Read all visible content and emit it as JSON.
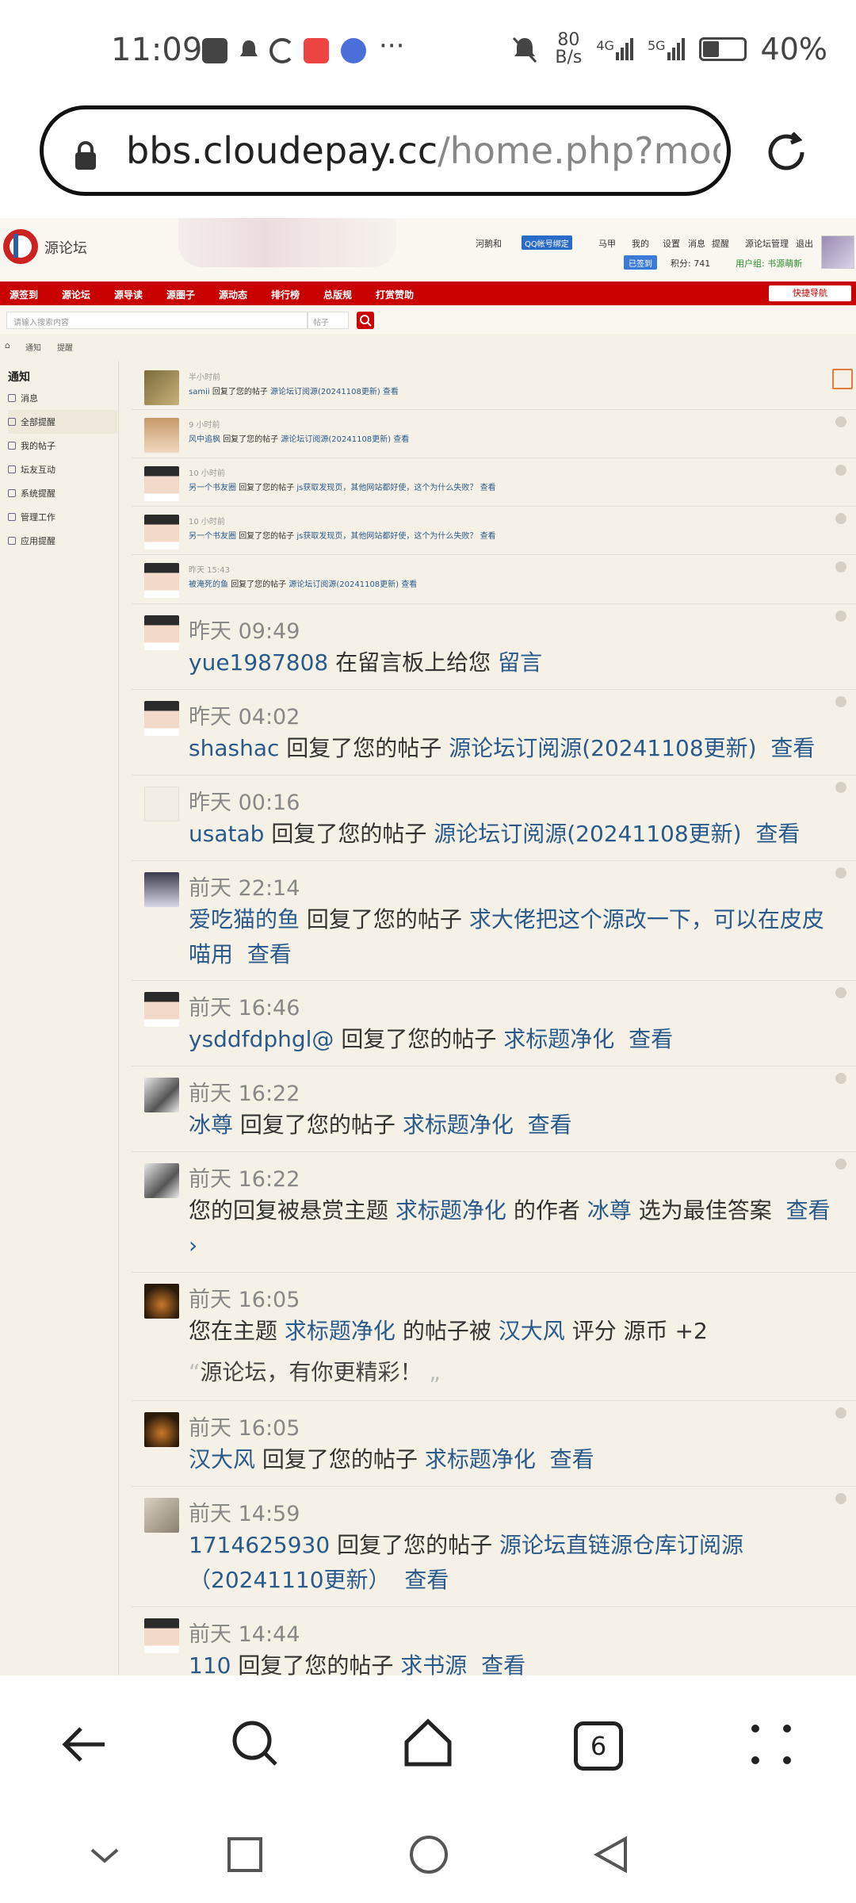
{
  "status_bar": {
    "time": "11:09",
    "net_speed_value": "80",
    "net_speed_unit": "B/s",
    "sig1": "4G",
    "sig2": "5G",
    "battery": "40%"
  },
  "browser": {
    "url_host": "bbs.cloudepay.cc",
    "url_path": "/home.php?mod=",
    "tab_count": "6"
  },
  "site": {
    "topnav": [
      "河鹅和",
      "QQ帐号绑定",
      "马甲",
      "我的",
      "设置",
      "消息",
      "提醒",
      "源论坛管理",
      "退出"
    ],
    "sign_label": "已签到",
    "points": "积分: 741",
    "group": "用户组: 书源萌新",
    "red_nav": [
      "源签到",
      "源论坛",
      "源导读",
      "源圈子",
      "源动态",
      "排行榜",
      "总版规",
      "打赏赞助"
    ],
    "quick_nav": "快捷导航",
    "search_placeholder": "请输入搜索内容",
    "search_select": "帖子",
    "breadcrumb": [
      "通知",
      "提醒"
    ]
  },
  "sidebar": {
    "title": "通知",
    "items": [
      {
        "label": "消息"
      },
      {
        "label": "全部提醒"
      },
      {
        "label": "我的帖子"
      },
      {
        "label": "坛友互动"
      },
      {
        "label": "系统提醒"
      },
      {
        "label": "管理工作"
      },
      {
        "label": "应用提醒"
      }
    ]
  },
  "notices_small": [
    {
      "time": "半小时前",
      "user": "samii",
      "action": "回复了您的帖子",
      "link": "源论坛订阅源(20241108更新)",
      "view": "查看"
    },
    {
      "time": "9 小时前",
      "user": "风中追枫",
      "action": "回复了您的帖子",
      "link": "源论坛订阅源(20241108更新)",
      "view": "查看"
    },
    {
      "time": "10 小时前",
      "user": "另一个书友圈",
      "action": "回复了您的帖子",
      "link": "js获取发现页，其他网站都好使，这个为什么失败？",
      "view": "查看"
    },
    {
      "time": "10 小时前",
      "user": "另一个书友圈",
      "action": "回复了您的帖子",
      "link": "js获取发现页，其他网站都好使，这个为什么失败？",
      "view": "查看"
    },
    {
      "time": "昨天 15:43",
      "user": "被淹死的鱼",
      "action": "回复了您的帖子",
      "link": "源论坛订阅源(20241108更新)",
      "view": "查看"
    }
  ],
  "notices_big": [
    {
      "time": "昨天 09:49",
      "user": "yue1987808",
      "action": "在留言板上给您",
      "link": "留言",
      "view": ""
    },
    {
      "time": "昨天 04:02",
      "user": "shashac",
      "action": "回复了您的帖子",
      "link": "源论坛订阅源(20241108更新)",
      "view": "查看"
    },
    {
      "time": "昨天 00:16",
      "user": "usatab",
      "action": "回复了您的帖子",
      "link": "源论坛订阅源(20241108更新)",
      "view": "查看"
    },
    {
      "time": "前天 22:14",
      "user": "爱吃猫的鱼",
      "action": "回复了您的帖子",
      "link": "求大佬把这个源改一下，可以在皮皮喵用",
      "view": "查看"
    },
    {
      "time": "前天 16:46",
      "user": "ysddfdphgl@",
      "action": "回复了您的帖子",
      "link": "求标题净化",
      "view": "查看"
    },
    {
      "time": "前天 16:22",
      "user": "冰尊",
      "action": "回复了您的帖子",
      "link": "求标题净化",
      "view": "查看"
    },
    {
      "time": "前天 16:22",
      "pre": "您的回复被悬赏主题",
      "link": "求标题净化",
      "mid": "的作者",
      "user": "冰尊",
      "post": "选为最佳答案",
      "view": "查看 ›"
    },
    {
      "time": "前天 16:05",
      "pre": "您在主题",
      "link": "求标题净化",
      "mid": "的帖子被",
      "user": "汉大风",
      "post": "评分 源币 +2",
      "quote": "源论坛，有你更精彩！"
    },
    {
      "time": "前天 16:05",
      "user": "汉大风",
      "action": "回复了您的帖子",
      "link": "求标题净化",
      "view": "查看"
    },
    {
      "time": "前天 14:59",
      "user": "1714625930",
      "action": "回复了您的帖子",
      "link": "源论坛直链源仓库订阅源（20241110更新）",
      "view": "查看"
    },
    {
      "time": "前天 14:44",
      "user": "110",
      "action": "回复了您的帖子",
      "link": "求书源",
      "view": "查看"
    }
  ],
  "colors": {
    "accent_red": "#c90000",
    "link_blue": "#2a5a8c"
  }
}
